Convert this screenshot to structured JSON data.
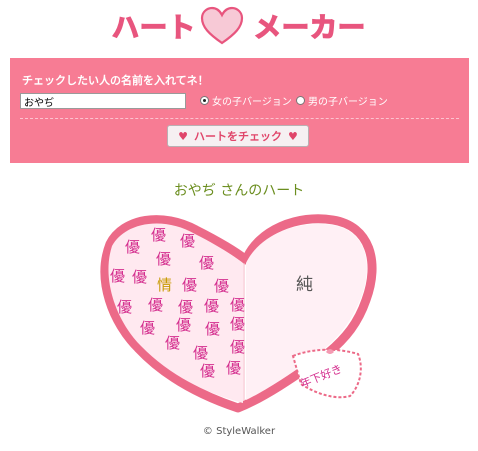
{
  "header": {
    "logo_left": "ハート",
    "logo_right": "メーカー",
    "colors": {
      "logo_fill": "#f7c9d6",
      "logo_stroke": "#e8557e"
    }
  },
  "form": {
    "prompt": "チェックしたい人の名前を入れてネ！",
    "name_value": "おやぢ",
    "radio_female": "女の子バージョン",
    "radio_male": "男の子バージョン",
    "selected": "female",
    "check_button": "ハートをチェック",
    "colors": {
      "panel": "#f77c94"
    }
  },
  "result": {
    "title": "おやぢ さんのハート",
    "left_kanji": [
      "優",
      "優",
      "優",
      "優",
      "優",
      "優",
      "優",
      "情",
      "優",
      "優",
      "優",
      "優",
      "優",
      "優",
      "優",
      "優",
      "優",
      "優",
      "優",
      "優",
      "優",
      "優",
      "優",
      "優"
    ],
    "right_kanji": "純",
    "tag": "年下好き",
    "colors": {
      "kanji": "#d42e8e",
      "kanji_alt": "#c89a00",
      "heart_outline": "#ec6a88",
      "heart_fill": "#ffe9f0"
    }
  },
  "footer": {
    "copyright": "StyleWalker",
    "copyright_symbol": "©"
  }
}
